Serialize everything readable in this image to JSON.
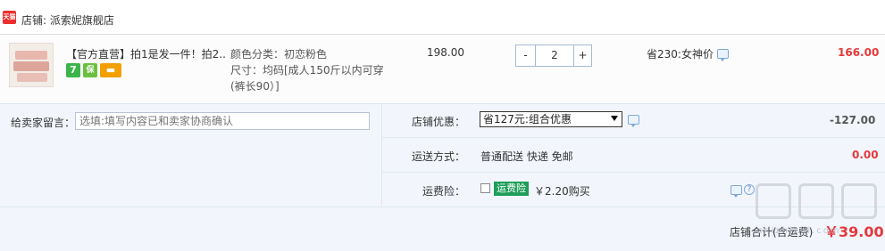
{
  "shop": {
    "badge_icon": "tmall-icon",
    "badge_text": "天猫",
    "label": "店铺: 派索妮旗舰店"
  },
  "item": {
    "title": "【官方直营】拍1是发一件！拍2...",
    "tags": [
      {
        "icon": "seven-day-return-icon",
        "text": "7"
      },
      {
        "icon": "insurance-icon",
        "text": "保"
      },
      {
        "icon": "card-payment-icon",
        "text": "▬"
      }
    ],
    "sku_color": "颜色分类：初恋粉色",
    "sku_size_line1": "尺寸：均码[成人150斤以内可穿",
    "sku_size_line2": "(裤长90）]",
    "unit_price": "198.00",
    "quantity": {
      "minus": "-",
      "value": "2",
      "plus": "+"
    },
    "savings": "省230:女神价",
    "total": "166.00"
  },
  "memo": {
    "label": "给卖家留言：",
    "placeholder": "选填:填写内容已和卖家协商确认"
  },
  "promotion": {
    "label": "店铺优惠：",
    "selected": "省127元:组合优惠",
    "amount": "-127.00"
  },
  "shipping": {
    "label": "运送方式：",
    "value": "普通配送 快递 免邮",
    "amount": "0.00"
  },
  "insurance": {
    "label": "运费险：",
    "badge": "运费险",
    "price": "￥2.20购买",
    "checked": false
  },
  "summary": {
    "label": "店铺合计(含运费)",
    "total": "￥39.00"
  },
  "watermark": {
    "text": "zhizhizhi.com"
  },
  "colors": {
    "accent_red": "#e4393c",
    "panel_blue": "#f2f6fc",
    "insurance_green": "#1e9e5a"
  }
}
